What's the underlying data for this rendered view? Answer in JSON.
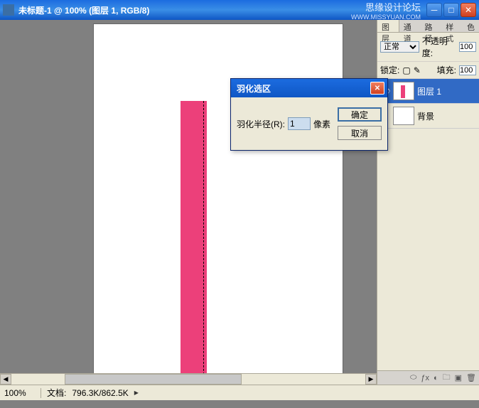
{
  "titlebar": {
    "title": "未标题-1 @ 100% (图层 1, RGB/8)",
    "watermark1": "思缘设计论坛",
    "watermark2": "WWW.MISSYUAN.COM"
  },
  "dialog": {
    "title": "羽化选区",
    "radius_label": "羽化半径(R):",
    "radius_value": "1",
    "unit": "像素",
    "ok": "确定",
    "cancel": "取消"
  },
  "panels": {
    "tabs": [
      "图层",
      "通道",
      "路径",
      "样式",
      "色"
    ],
    "blend_mode_label": "正常",
    "opacity_label": "不透明度:",
    "opacity_value": "100",
    "lock_label": "锁定:",
    "fill_label": "填充:",
    "fill_value": "100",
    "layers": [
      {
        "name": "图层 1",
        "selected": true,
        "thumb": "pink"
      },
      {
        "name": "背景",
        "selected": false,
        "thumb": "white"
      }
    ]
  },
  "statusbar": {
    "zoom": "100%",
    "doc_label": "文档:",
    "doc_info": "796.3K/862.5K"
  }
}
